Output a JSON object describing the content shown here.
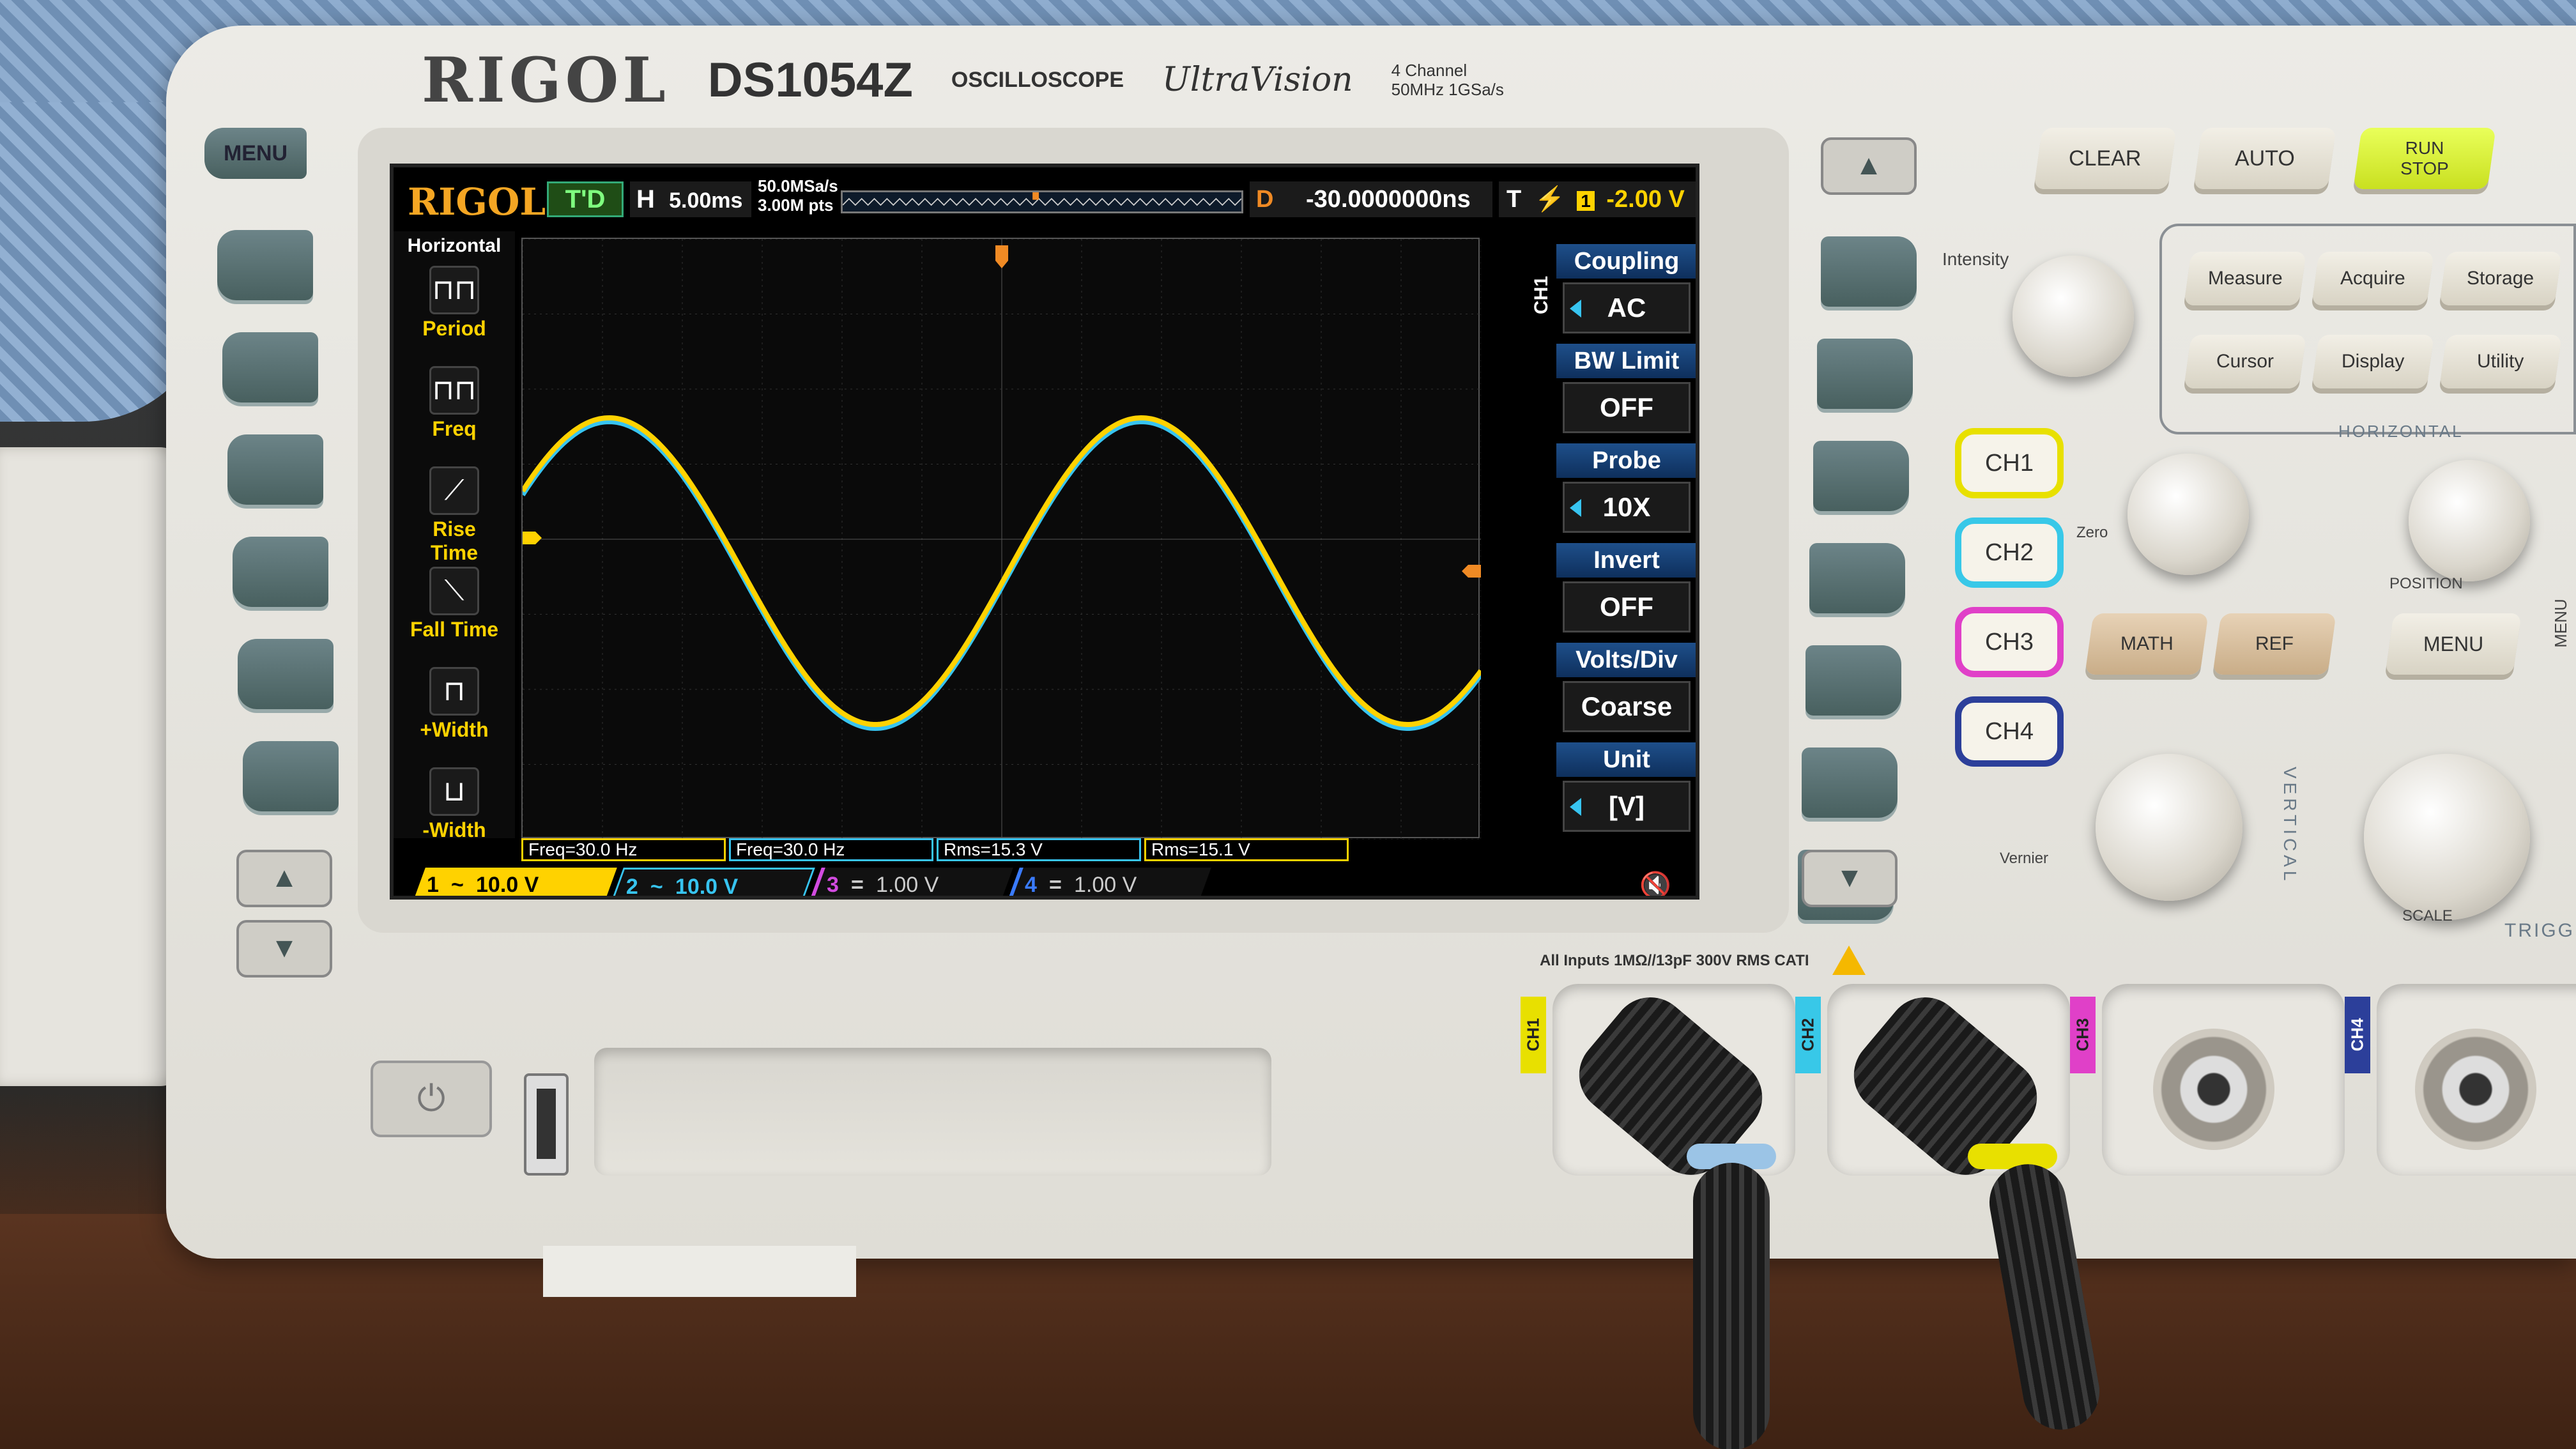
{
  "device": {
    "brand": "RIGOL",
    "model": "DS1054Z",
    "type_label": "OSCILLOSCOPE",
    "series": "UltraVision",
    "spec_line1": "4 Channel",
    "spec_line2": "50MHz  1GSa/s",
    "menu_key": "MENU"
  },
  "screen": {
    "logo": "RIGOL",
    "run_state": "T'D",
    "horizontal": {
      "label": "H",
      "timebase": "5.00ms"
    },
    "sample_rate": "50.0MSa/s",
    "memory_depth": "3.00M pts",
    "delay": {
      "label": "D",
      "value": "-30.0000000ns"
    },
    "trigger": {
      "label": "T",
      "source": "1",
      "level": "-2.00 V",
      "color": "#ffd200"
    },
    "left_menu": {
      "title": "Horizontal",
      "items": [
        {
          "icon": "period-icon",
          "label": "Period"
        },
        {
          "icon": "freq-icon",
          "label": "Freq"
        },
        {
          "icon": "rise-time-icon",
          "label": "Rise Time"
        },
        {
          "icon": "fall-time-icon",
          "label": "Fall Time"
        },
        {
          "icon": "plus-width-icon",
          "label": "+Width"
        },
        {
          "icon": "minus-width-icon",
          "label": "-Width"
        }
      ]
    },
    "channel_menu_tag": "CH1",
    "right_menu": [
      {
        "header": "Coupling",
        "value": "AC",
        "has_arrow": true
      },
      {
        "header": "BW Limit",
        "value": "OFF",
        "has_arrow": false
      },
      {
        "header": "Probe",
        "value": "10X",
        "has_arrow": true
      },
      {
        "header": "Invert",
        "value": "OFF",
        "has_arrow": false
      },
      {
        "header": "Volts/Div",
        "value": "Coarse",
        "has_arrow": false
      },
      {
        "header": "Unit",
        "value": "[V]",
        "has_arrow": true
      }
    ],
    "measurements": [
      {
        "text": "Freq=30.0 Hz",
        "color": "#ffd200"
      },
      {
        "text": "Freq=30.0 Hz",
        "color": "#37c4f0"
      },
      {
        "text": "Rms=15.3 V",
        "color": "#37c4f0"
      },
      {
        "text": "Rms=15.1 V",
        "color": "#ffd200"
      }
    ],
    "channels": [
      {
        "num": "1",
        "coupling": "~",
        "scale": "10.0 V",
        "color": "#ffd200",
        "active": true
      },
      {
        "num": "2",
        "coupling": "~",
        "scale": "10.0 V",
        "color": "#37c4f0",
        "active": false
      },
      {
        "num": "3",
        "coupling": "=",
        "scale": "1.00 V",
        "color": "#d24be0",
        "active": false
      },
      {
        "num": "4",
        "coupling": "=",
        "scale": "1.00 V",
        "color": "#3a7bff",
        "active": false
      }
    ],
    "waveform": {
      "ch1_color": "#ffd200",
      "ch2_color": "#37c4f0",
      "frequency_hz": 30.0
    }
  },
  "panel": {
    "top_buttons": [
      "CLEAR",
      "AUTO",
      "RUN STOP"
    ],
    "intensity_label": "Intensity",
    "menu_buttons": [
      "Measure",
      "Acquire",
      "Storage",
      "Cursor",
      "Display",
      "Utility"
    ],
    "menu_label": "MENU",
    "channel_buttons": [
      {
        "label": "CH1",
        "color": "#e8e000"
      },
      {
        "label": "CH2",
        "color": "#38c8e8"
      },
      {
        "label": "CH3",
        "color": "#e040c8"
      },
      {
        "label": "CH4",
        "color": "#2c3f9a"
      }
    ],
    "math_button": "MATH",
    "ref_button": "REF",
    "horizontal_label": "HORIZONTAL",
    "horizontal_menu": "MENU",
    "position_label": "POSITION",
    "scale_label": "SCALE",
    "vertical_label": "VERTICAL",
    "vernier_label": "Vernier",
    "zero_label": "Zero",
    "trigger_label": "TRIGGER"
  },
  "inputs": {
    "label": "All Inputs 1MΩ//13pF 300V RMS  CATI",
    "ports": [
      "CH1",
      "CH2",
      "CH3",
      "CH4"
    ]
  }
}
